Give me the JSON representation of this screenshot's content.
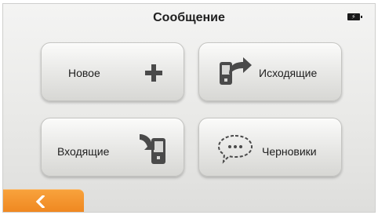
{
  "header": {
    "title": "Сообщение",
    "battery_icon": "battery-charging-icon"
  },
  "tiles": [
    {
      "label": "Новое",
      "icon": "plus-icon"
    },
    {
      "label": "Исходящие",
      "icon": "phone-outgoing-icon"
    },
    {
      "label": "Входящие",
      "icon": "phone-incoming-icon"
    },
    {
      "label": "Черновики",
      "icon": "speech-bubble-icon"
    }
  ],
  "footer": {
    "back_icon": "chevron-left-icon"
  },
  "colors": {
    "accent": "#f39028",
    "icon": "#4a4a4a"
  }
}
